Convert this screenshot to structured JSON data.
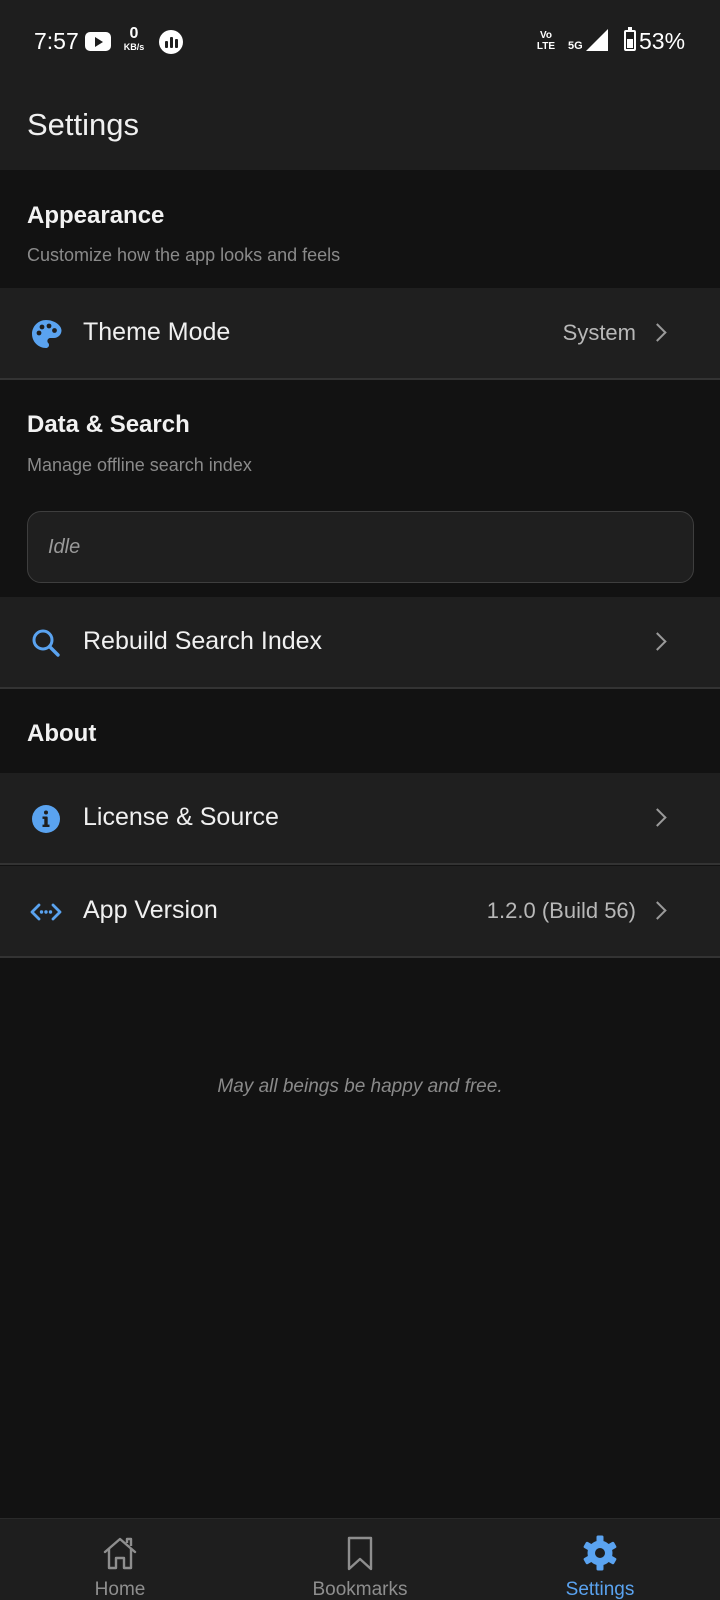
{
  "status_bar": {
    "time": "7:57",
    "net_speed_value": "0",
    "net_speed_unit": "KB/s",
    "volte_line1": "Vo",
    "volte_line2": "LTE",
    "network": "5G",
    "battery": "53%",
    "icons": [
      "youtube-icon",
      "net-speed-icon",
      "stats-icon",
      "volte-icon",
      "signal-icon",
      "battery-icon"
    ]
  },
  "header": {
    "title": "Settings"
  },
  "sections": {
    "appearance": {
      "title": "Appearance",
      "subtitle": "Customize how the app looks and feels",
      "theme_mode": {
        "label": "Theme Mode",
        "value": "System",
        "icon": "palette-icon"
      }
    },
    "data_search": {
      "title": "Data & Search",
      "subtitle": "Manage offline search index",
      "index_status": "Idle",
      "rebuild": {
        "label": "Rebuild Search Index",
        "icon": "search-icon"
      }
    },
    "about": {
      "title": "About",
      "license": {
        "label": "License & Source",
        "icon": "info-icon"
      },
      "version": {
        "label": "App Version",
        "value": "1.2.0 (Build 56)",
        "icon": "code-icon"
      }
    }
  },
  "footer": {
    "quote": "May all beings be happy and free."
  },
  "bottom_nav": {
    "items": [
      {
        "label": "Home",
        "icon": "home-icon",
        "active": false
      },
      {
        "label": "Bookmarks",
        "icon": "bookmark-icon",
        "active": false
      },
      {
        "label": "Settings",
        "icon": "gear-icon",
        "active": true
      }
    ]
  },
  "colors": {
    "accent": "#5aa3f0",
    "background": "#121212",
    "surface": "#1f1f1f",
    "divider": "#333333"
  }
}
